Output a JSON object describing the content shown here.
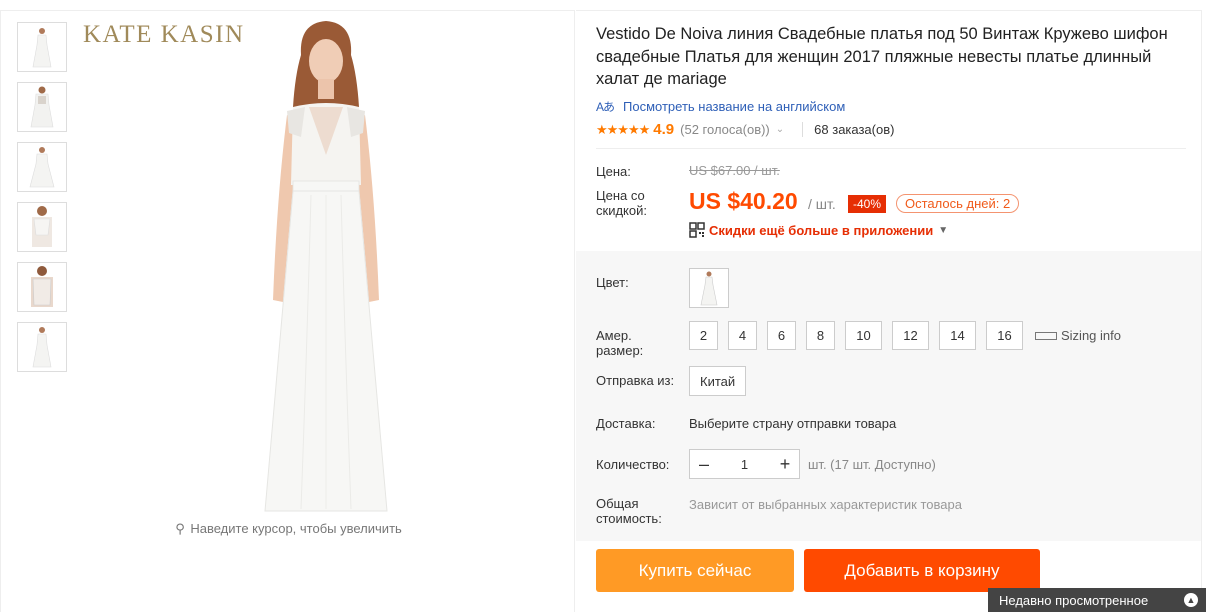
{
  "gallery": {
    "brand": "KATE KASIN",
    "zoom_hint": "Наведите курсор, чтобы увеличить",
    "thumbnail_count": 6
  },
  "product": {
    "title": "Vestido De Noiva линия Свадебные платья под 50 Винтаж Кружево шифон свадебные Платья для женщин 2017 пляжные невесты платье длинный халат де mariage",
    "translate_icon": "Aあ",
    "translate_link": "Посмотреть название на английском",
    "stars": "★★★★★",
    "rating": "4.9",
    "votes": "(52 голоса(ов))",
    "orders": "68 заказа(ов)"
  },
  "price": {
    "price_label": "Цена:",
    "old_price": "US $67.00 / шт.",
    "discount_label": "Цена со скидкой:",
    "new_price": "US $40.20",
    "unit": "/ шт.",
    "discount_badge": "-40%",
    "days_left": "Осталось дней: 2",
    "app_deal": "Скидки ещё больше в приложении"
  },
  "options": {
    "color_label": "Цвет:",
    "size_label": "Амер. размер:",
    "sizes": [
      "2",
      "4",
      "6",
      "8",
      "10",
      "12",
      "14",
      "16"
    ],
    "sizing_info": "Sizing info",
    "ship_from_label": "Отправка из:",
    "ship_from_value": "Китай",
    "delivery_label": "Доставка:",
    "delivery_value": "Выберите страну отправки товара",
    "quantity_label": "Количество:",
    "quantity_value": "1",
    "quantity_note": "шт. (17 шт. Доступно)",
    "total_label": "Общая стоимость:",
    "total_note": "Зависит от выбранных характеристик товара"
  },
  "actions": {
    "buy_now": "Купить сейчас",
    "add_to_cart": "Добавить в корзину"
  },
  "footer": {
    "recently_viewed": "Недавно просмотренное"
  },
  "colors": {
    "accent_orange": "#ff4a00",
    "buy_button": "#ff9a25",
    "link_blue": "#2e5fb7",
    "star": "#ff7a00"
  }
}
